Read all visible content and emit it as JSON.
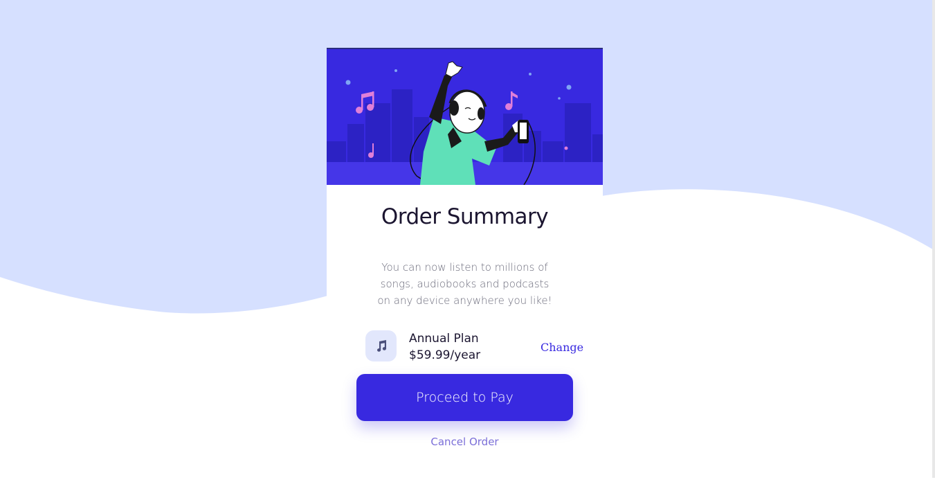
{
  "card": {
    "title": "Order Summary",
    "description": "You can now listen to millions of songs, audiobooks and podcasts on any device anywhere you like!",
    "plan": {
      "icon": "music-note-icon",
      "name": "Annual Plan",
      "price": "$59.99/year",
      "change_label": "Change"
    },
    "pay_button_label": "Proceed to Pay",
    "cancel_label": "Cancel Order"
  },
  "colors": {
    "accent": "#3829e0",
    "background_pale": "#d6e0ff",
    "icon_box": "#e2e7fc",
    "title_text": "#1b1530",
    "muted_text": "#6a6a7a",
    "cancel_text": "#7b6fd8"
  }
}
